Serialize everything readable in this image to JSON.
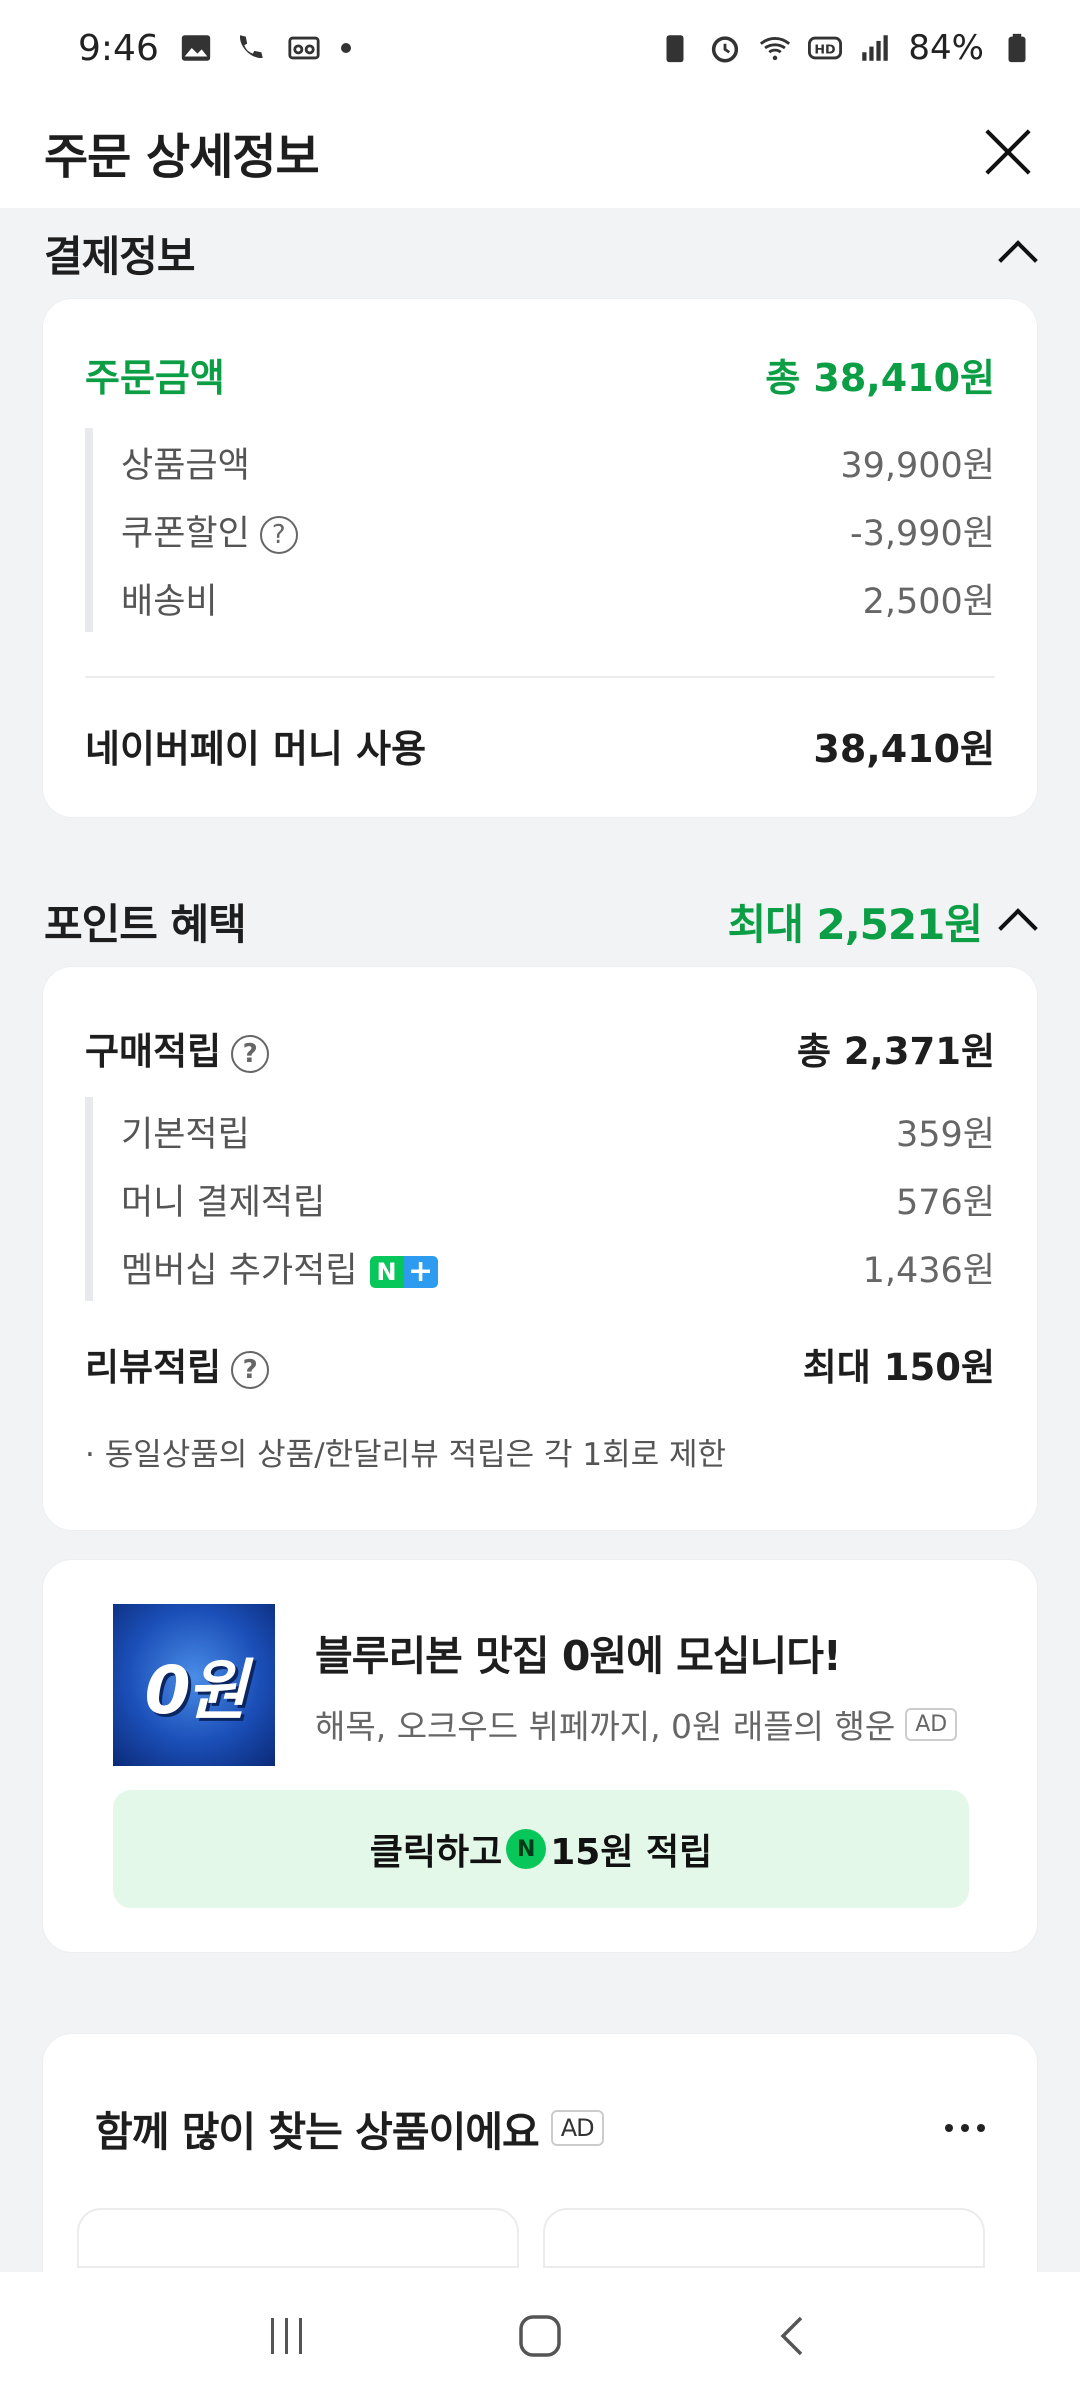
{
  "status_bar": {
    "time": "9:46",
    "battery": "84%"
  },
  "header": {
    "title": "주문 상세정보"
  },
  "payment": {
    "section_title": "결제정보",
    "order_amount_label": "주문금액",
    "order_amount_value": "총 38,410원",
    "items": [
      {
        "label": "상품금액",
        "value": "39,900원"
      },
      {
        "label": "쿠폰할인",
        "value": "-3,990원"
      },
      {
        "label": "배송비",
        "value": "2,500원"
      }
    ],
    "method_label": "네이버페이 머니 사용",
    "method_value": "38,410원"
  },
  "points": {
    "section_title": "포인트 혜택",
    "max_value": "최대 2,521원",
    "purchase_label": "구매적립",
    "purchase_total": "총 2,371원",
    "items": [
      {
        "label": "기본적립",
        "value": "359원"
      },
      {
        "label": "머니 결제적립",
        "value": "576원"
      },
      {
        "label": "멤버십 추가적립",
        "value": "1,436원"
      }
    ],
    "review_label": "리뷰적립",
    "review_value": "최대 150원",
    "note": "· 동일상품의 상품/한달리뷰 적립은 각 1회로 제한"
  },
  "ad": {
    "thumb_text": "0원",
    "title": "블루리본 맛집 0원에 모십니다!",
    "subtitle": "해목, 오크우드 뷔페까지, 0원 래플의 행운",
    "badge": "AD",
    "cta_prefix": "클릭하고",
    "cta_suffix": "15원 적립"
  },
  "recommend": {
    "title": "함께 많이 찾는 상품이에요",
    "badge": "AD"
  },
  "colors": {
    "accent_green": "#0b9e45",
    "naver_green": "#08c75a",
    "cta_bg": "#e3f8e8"
  }
}
